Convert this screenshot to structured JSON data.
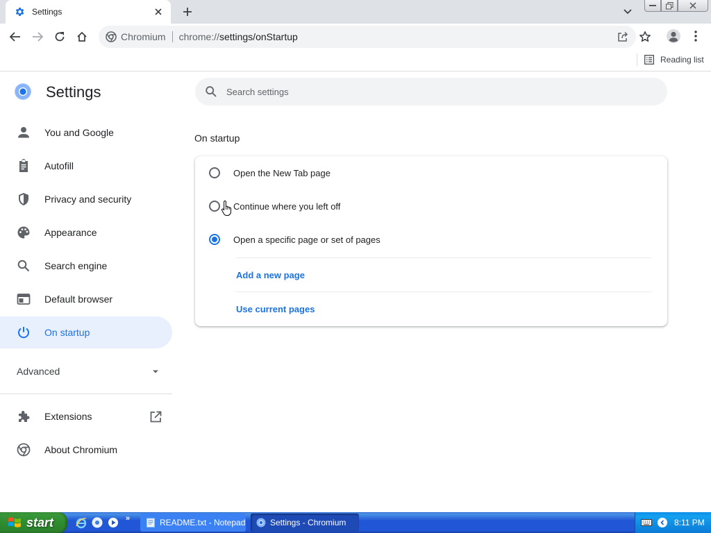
{
  "browser": {
    "tab_title": "Settings",
    "site_name": "Chromium",
    "url_scheme": "chrome://",
    "url_host_path": "settings/onStartup",
    "reading_list_label": "Reading list"
  },
  "settings": {
    "title": "Settings",
    "search_placeholder": "Search settings",
    "nav": [
      {
        "label": "You and Google",
        "icon": "person-icon"
      },
      {
        "label": "Autofill",
        "icon": "clipboard-icon"
      },
      {
        "label": "Privacy and security",
        "icon": "shield-icon"
      },
      {
        "label": "Appearance",
        "icon": "palette-icon"
      },
      {
        "label": "Search engine",
        "icon": "search-icon"
      },
      {
        "label": "Default browser",
        "icon": "browser-window-icon"
      },
      {
        "label": "On startup",
        "icon": "power-icon",
        "active": true
      }
    ],
    "advanced_label": "Advanced",
    "extensions_label": "Extensions",
    "about_label": "About Chromium",
    "section_title": "On startup",
    "options": [
      {
        "label": "Open the New Tab page",
        "checked": false
      },
      {
        "label": "Continue where you left off",
        "checked": false
      },
      {
        "label": "Open a specific page or set of pages",
        "checked": true
      }
    ],
    "links": {
      "add_page": "Add a new page",
      "use_current": "Use current pages"
    }
  },
  "taskbar": {
    "start_label": "start",
    "tasks": [
      {
        "label": "README.txt - Notepad",
        "active": false
      },
      {
        "label": "Settings - Chromium",
        "active": true
      }
    ],
    "clock": "8:11 PM"
  },
  "colors": {
    "accent": "#1a73e8",
    "nav_active_bg": "#e8f0fe",
    "taskbar_blue": "#2157d7",
    "start_green": "#3c9a3c"
  }
}
